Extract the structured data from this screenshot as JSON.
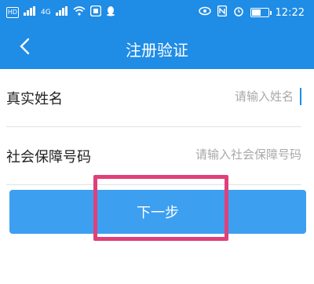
{
  "status_bar": {
    "left_labels": [
      "HD",
      "4G",
      "4G"
    ],
    "time": "12:22",
    "battery_percent": 55
  },
  "header": {
    "title": "注册验证",
    "back_icon": "chevron-left-icon"
  },
  "form": {
    "name": {
      "label": "真实姓名",
      "placeholder": "请输入姓名",
      "value": ""
    },
    "ssn": {
      "label": "社会保障号码",
      "placeholder": "请输入社会保障号码",
      "value": ""
    }
  },
  "next_button": {
    "label": "下一步"
  },
  "colors": {
    "primary": "#1f8ce6",
    "button": "#3d9ff0",
    "highlight": "#e0407a"
  }
}
